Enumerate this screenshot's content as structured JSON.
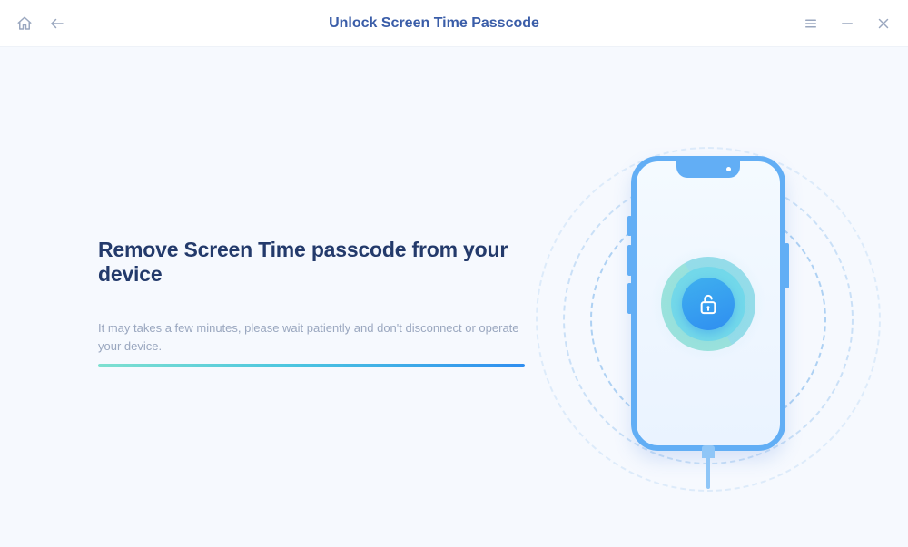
{
  "titlebar": {
    "title": "Unlock Screen Time Passcode"
  },
  "main": {
    "heading": "Remove Screen Time passcode from your device",
    "subtext": "It may takes a few minutes, please wait patiently and don't disconnect or operate your device."
  }
}
